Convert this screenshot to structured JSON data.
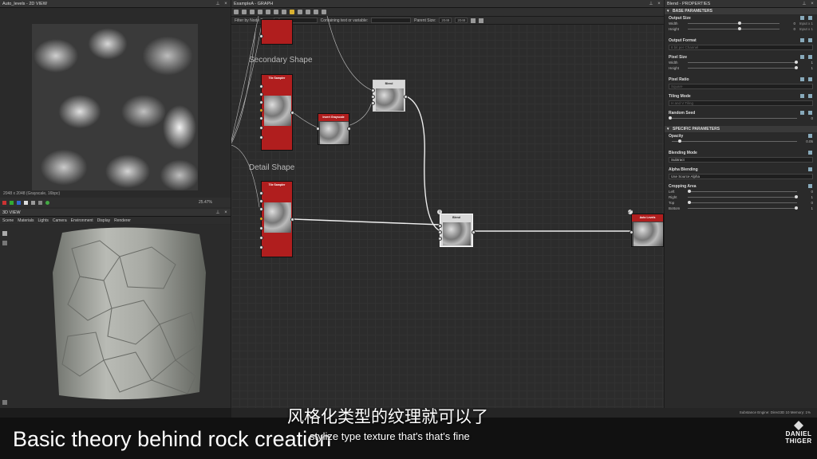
{
  "view2d": {
    "title": "Auto_levels - 2D VIEW",
    "info": "2048 x 2048 (Grayscale, 16bpc)",
    "zoom": "25.47%"
  },
  "view3d": {
    "title": "3D VIEW",
    "menu": [
      "Scene",
      "Materials",
      "Lights",
      "Camera",
      "Environment",
      "Display",
      "Renderer"
    ]
  },
  "graph": {
    "title": "ExampleA - GRAPH",
    "filter_label": "Filter by Node Type:",
    "filter_value": "All",
    "contains_label": "Containing text or variable:",
    "parent_size_label": "Parent Size:",
    "parent_size_w": "2048",
    "parent_size_h": "2048",
    "frames": {
      "secondary": "Secondary Shape",
      "detail": "Detail Shape"
    },
    "nodes": {
      "tile_sampler_1": "Tile Sampler",
      "tile_sampler_2": "Tile Sampler",
      "invert_grayscale": "Invert Grayscale",
      "blend_1": "Blend",
      "blend_2": "Blend",
      "auto_levels": "Auto Levels"
    }
  },
  "props": {
    "title": "Blend - PROPERTIES",
    "base_section": "BASE PARAMETERS",
    "specific_section": "SPECIFIC PARAMETERS",
    "output_size": {
      "label": "Output Size",
      "width_label": "Width",
      "width_value": "0",
      "width_extra": "Input x 1",
      "height_label": "Height",
      "height_value": "0",
      "height_extra": "Input x 1"
    },
    "output_format": {
      "label": "Output Format",
      "value": "8 bit per Channel"
    },
    "pixel_size": {
      "label": "Pixel Size",
      "width_label": "Width",
      "width_value": "1",
      "height_label": "Height",
      "height_value": "1"
    },
    "pixel_ratio": {
      "label": "Pixel Ratio",
      "value": "Square"
    },
    "tiling_mode": {
      "label": "Tiling Mode",
      "value": "H and V Tiling"
    },
    "random_seed": {
      "label": "Random Seed",
      "value": "0"
    },
    "opacity": {
      "label": "Opacity",
      "value": "0.05",
      "fraction": 0.05
    },
    "blending_mode": {
      "label": "Blending Mode",
      "value": "Subtract"
    },
    "alpha_blending": {
      "label": "Alpha Blending",
      "value": "Use Source Alpha"
    },
    "cropping_area": {
      "label": "Cropping Area",
      "left_label": "Left",
      "left_value": "0",
      "right_label": "Right",
      "right_value": "1",
      "top_label": "Top",
      "top_value": "0",
      "bottom_label": "Bottom",
      "bottom_value": "1"
    }
  },
  "status": "Substance Engine: Direct3D 10   Memory: 1%",
  "overlay": {
    "lecture_title": "Basic theory behind rock creation",
    "subtitle_cn": "风格化类型的纹理就可以了",
    "subtitle_en": "stylize type texture that's that's fine",
    "brand_line1": "DANIEL",
    "brand_line2": "THIGER"
  }
}
